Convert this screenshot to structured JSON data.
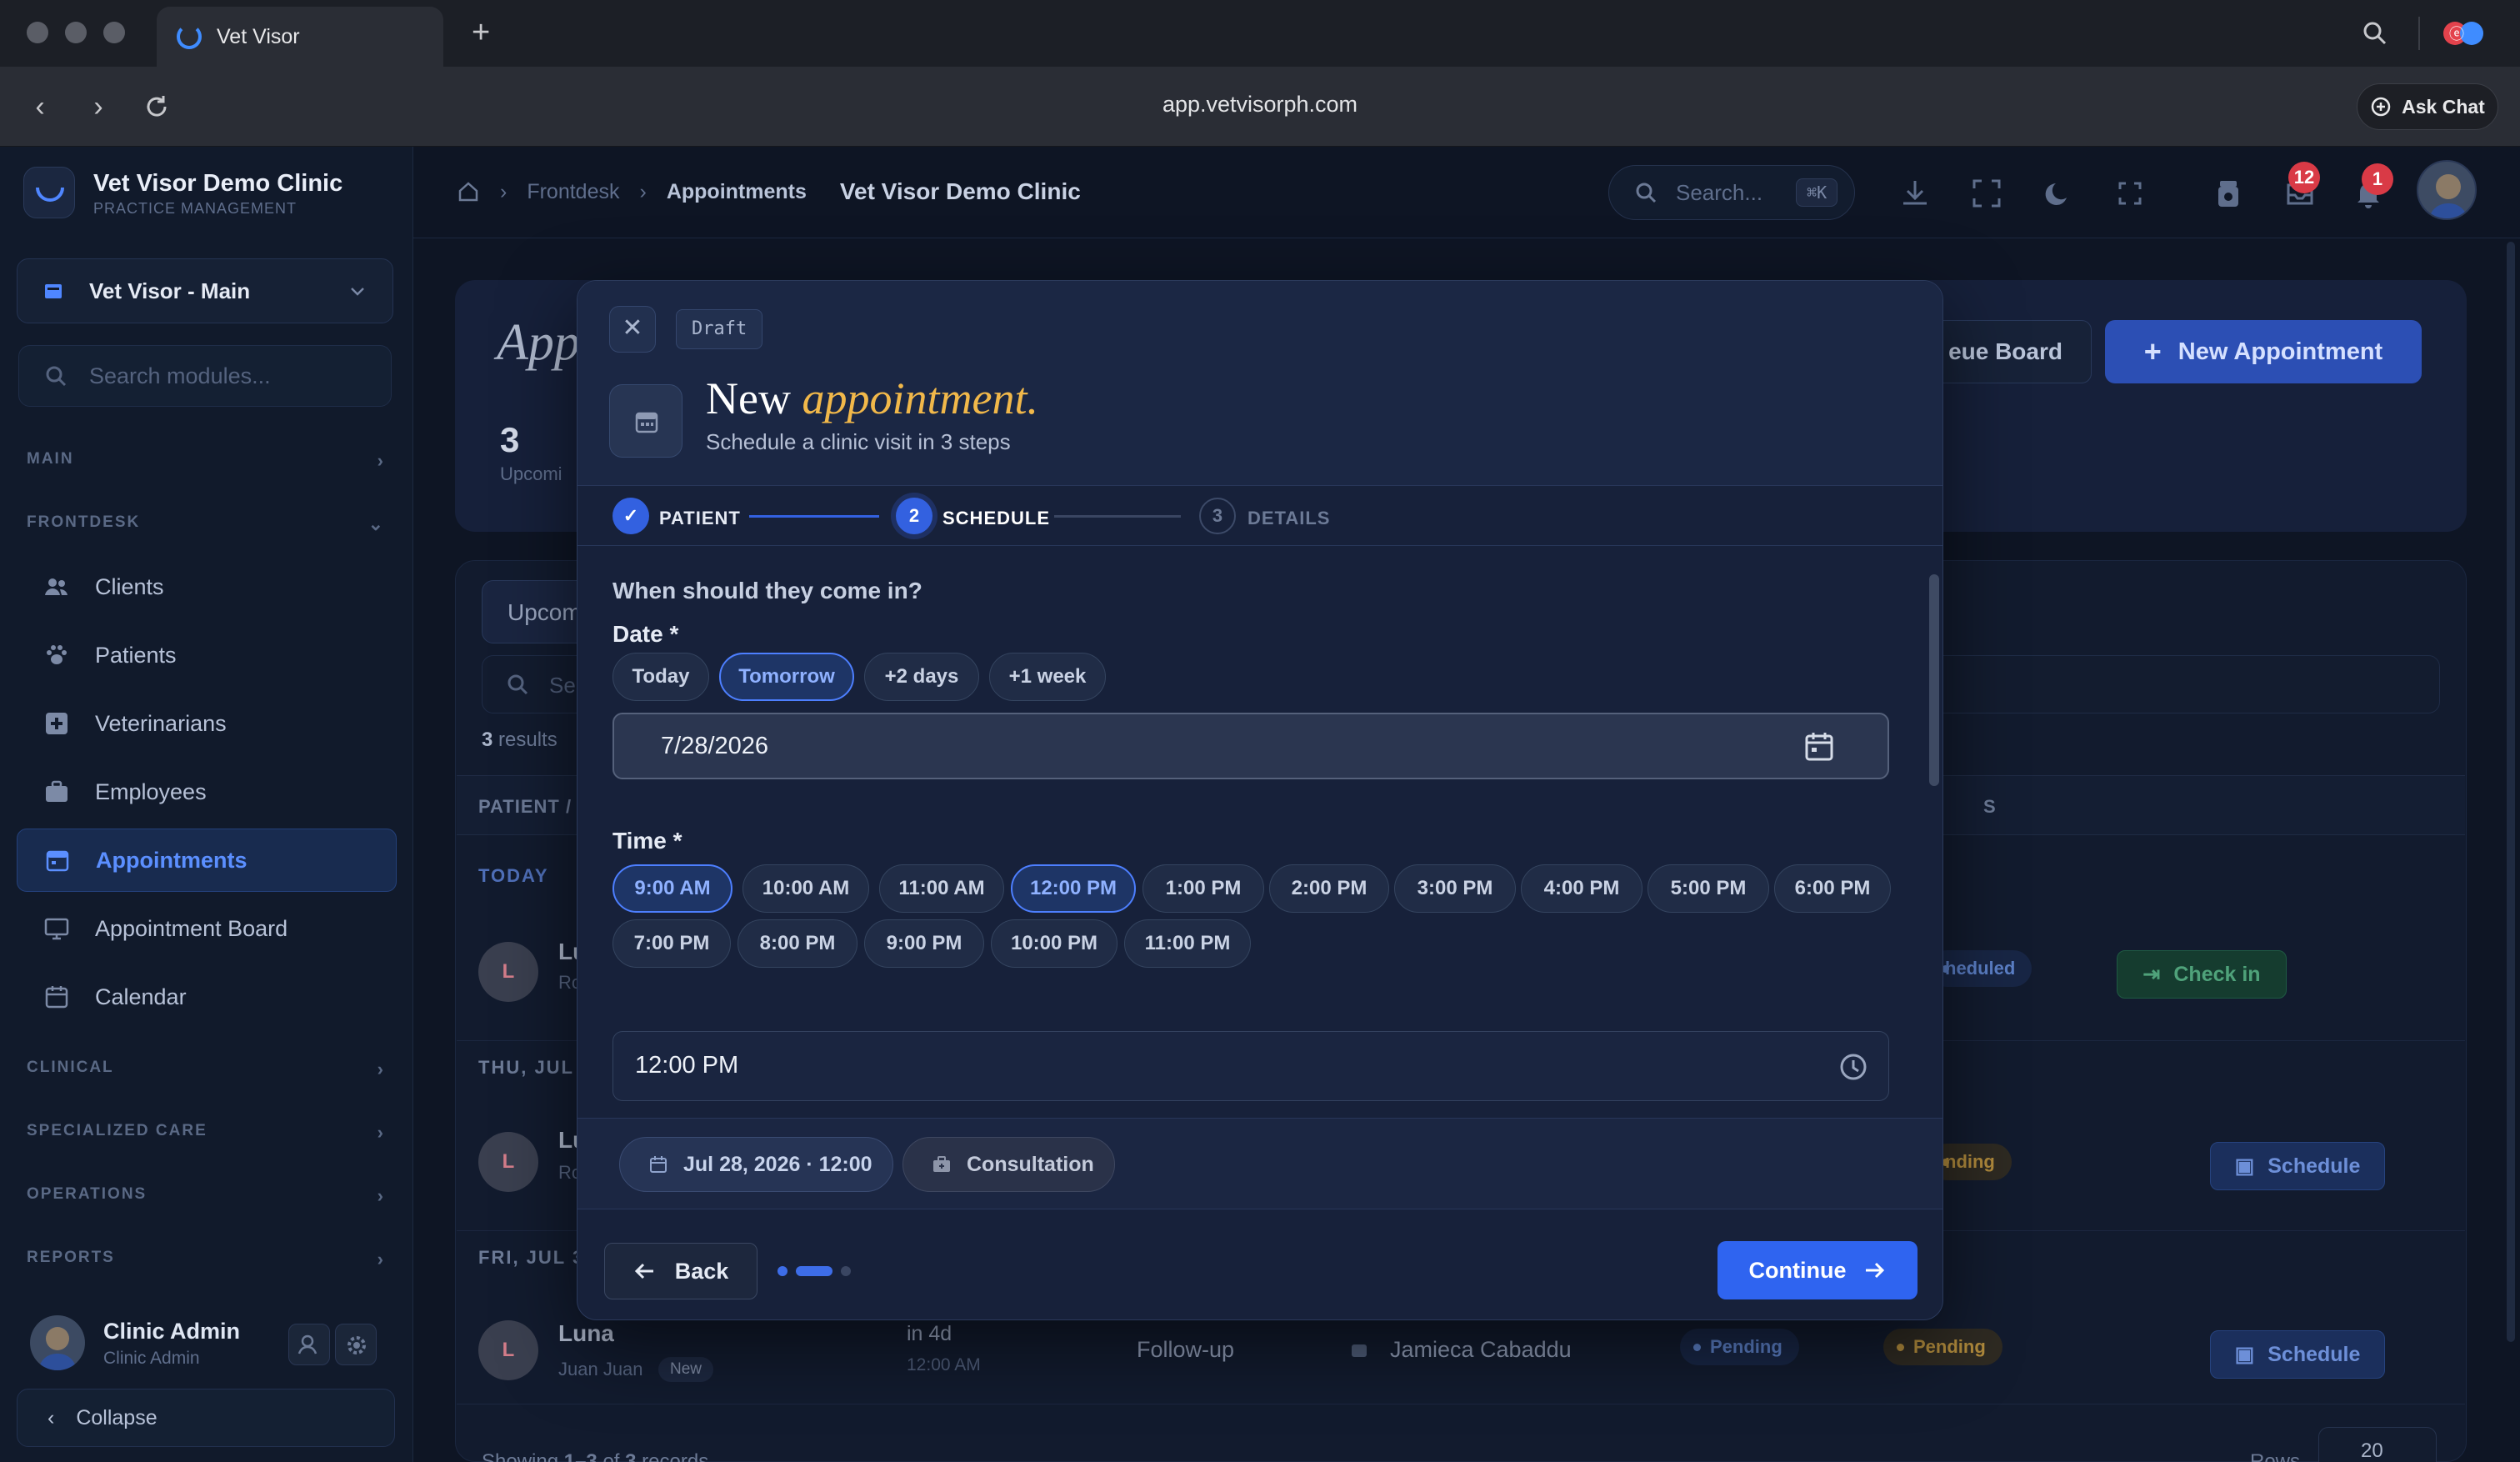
{
  "browser": {
    "tab_title": "Vet Visor",
    "url": "app.vetvisorph.com",
    "ask_chat": "Ask Chat",
    "new_tab": "+"
  },
  "sidebar": {
    "brand_name": "Vet Visor Demo Clinic",
    "brand_sub": "PRACTICE MANAGEMENT",
    "branch": "Vet Visor - Main",
    "search_placeholder": "Search modules...",
    "sections": {
      "main": "MAIN",
      "frontdesk": "FRONTDESK",
      "clinical": "CLINICAL",
      "specialized": "SPECIALIZED CARE",
      "operations": "OPERATIONS",
      "reports": "REPORTS"
    },
    "items": [
      {
        "label": "Clients",
        "icon": "users-icon"
      },
      {
        "label": "Patients",
        "icon": "paw-icon"
      },
      {
        "label": "Veterinarians",
        "icon": "medical-cross-icon"
      },
      {
        "label": "Employees",
        "icon": "briefcase-icon"
      },
      {
        "label": "Appointments",
        "icon": "calendar-icon",
        "active": true
      },
      {
        "label": "Appointment Board",
        "icon": "monitor-icon"
      },
      {
        "label": "Calendar",
        "icon": "calendar-grid-icon"
      }
    ],
    "user": {
      "name": "Clinic Admin",
      "role": "Clinic Admin"
    },
    "collapse": "Collapse"
  },
  "topbar": {
    "crumb_1": "Frontdesk",
    "crumb_2": "Appointments",
    "clinic": "Vet Visor Demo Clinic",
    "search_placeholder": "Search...",
    "search_kbd": "⌘K",
    "inbox_count": "12",
    "notif_count": "1"
  },
  "page": {
    "title": "App",
    "count": "3",
    "count_label": "Upcomi",
    "queue_board": "eue Board",
    "new_appointment": "New Appointment",
    "tab": "Upcom",
    "filter_placeholder": "Se",
    "results_count": "3",
    "results_label": "results",
    "col_patient": "PATIENT /",
    "col_status": "S",
    "groups": [
      "TODAY",
      "THU, JUL",
      "FRI, JUL 3"
    ],
    "rows": [
      {
        "initial": "L",
        "name": "Lu",
        "sub": "Ro",
        "status": "heduled",
        "action": "Check in"
      },
      {
        "initial": "L",
        "name": "Lu",
        "sub": "Ro",
        "status": "nding",
        "action": "Schedule"
      },
      {
        "initial": "L",
        "name": "Luna",
        "sub": "Juan Juan",
        "tag": "New",
        "when": "in 4d",
        "when_sub": "12:00 AM",
        "type": "Follow-up",
        "vet": "Jamieca Cabaddu",
        "status_1": "Pending",
        "status_2": "Pending",
        "action": "Schedule"
      }
    ],
    "footer_pre": "Showing ",
    "footer_range": "1–3",
    "footer_mid": " of ",
    "footer_total": "3",
    "footer_post": " records",
    "rows_label": "Rows",
    "rows_value": "20"
  },
  "modal": {
    "draft": "Draft",
    "title_plain": "New",
    "title_accent": "appointment.",
    "subtitle": "Schedule a clinic visit in 3 steps",
    "steps": [
      {
        "num": "✓",
        "label": "PATIENT",
        "state": "done"
      },
      {
        "num": "2",
        "label": "SCHEDULE",
        "state": "current"
      },
      {
        "num": "3",
        "label": "DETAILS",
        "state": "todo"
      }
    ],
    "question": "When should they come in?",
    "date_label": "Date *",
    "date_chips": [
      "Today",
      "Tomorrow",
      "+2 days",
      "+1 week"
    ],
    "date_selected": "Tomorrow",
    "date_value": "7/28/2026",
    "time_label": "Time *",
    "time_chips": [
      "9:00 AM",
      "10:00 AM",
      "11:00 AM",
      "12:00 PM",
      "1:00 PM",
      "2:00 PM",
      "3:00 PM",
      "4:00 PM",
      "5:00 PM",
      "6:00 PM",
      "7:00 PM",
      "8:00 PM",
      "9:00 PM",
      "10:00 PM",
      "11:00 PM"
    ],
    "time_selected": [
      "9:00 AM",
      "12:00 PM"
    ],
    "time_value": "12:00 PM",
    "summary_datetime": "Jul 28, 2026 · 12:00",
    "summary_type": "Consultation",
    "back": "Back",
    "continue": "Continue",
    "current_step": 2,
    "total_steps": 3
  },
  "colors": {
    "accent": "#3361e0",
    "title_accent": "#f1b84a",
    "badge_red": "#d93a46"
  }
}
